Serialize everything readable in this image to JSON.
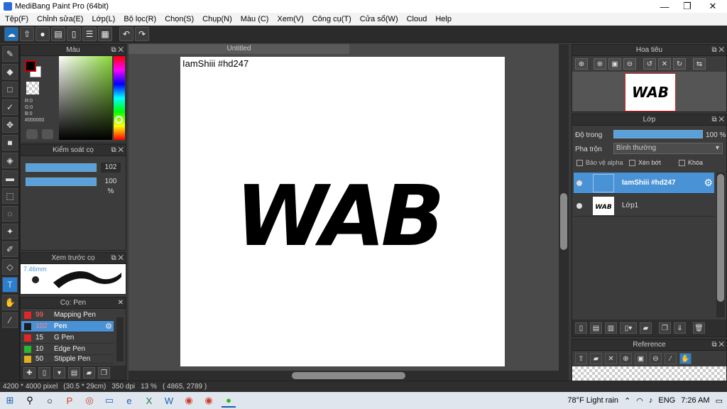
{
  "window": {
    "title": "MediBang Paint Pro (64bit)",
    "minimize": "—",
    "maximize": "❐",
    "close": "✕"
  },
  "menu": [
    "Tệp(F)",
    "Chỉnh sửa(E)",
    "Lớp(L)",
    "Bộ lọc(R)",
    "Chọn(S)",
    "Chụp(N)",
    "Màu (C)",
    "Xem(V)",
    "Công cụ(T)",
    "Cửa sổ(W)",
    "Cloud",
    "Help"
  ],
  "toolbar_icons": [
    "cloud-icon",
    "upload-icon",
    "chat-icon",
    "comment-icon",
    "document-icon",
    "list-icon",
    "grid-icon",
    "undo-icon",
    "redo-icon"
  ],
  "tools": [
    "brush-icon",
    "eraser-icon",
    "rectangle-icon",
    "smudge-icon",
    "move-icon",
    "fill-rect-icon",
    "bucket-icon",
    "gradient-icon",
    "select-rect-icon",
    "lasso-icon",
    "magic-wand-icon",
    "select-pen-icon",
    "select-eraser-icon",
    "text-icon",
    "hand-icon",
    "eyedropper-icon",
    "operation-icon"
  ],
  "color_panel": {
    "title": "Màu",
    "r": "R:0",
    "g": "G:0",
    "b": "B:0",
    "hex": "#000000"
  },
  "brush_control": {
    "title": "Kiểm soát cọ",
    "size": "102",
    "opacity": "100 %"
  },
  "brush_preview": {
    "title": "Xem trước cọ",
    "size": "7.46mm"
  },
  "brush_list": {
    "title": "Cọ: Pen",
    "items": [
      {
        "num": "99",
        "name": "Mapping Pen",
        "color": "#e02626"
      },
      {
        "num": "102",
        "name": "Pen",
        "color": "#1e1e1e"
      },
      {
        "num": "15",
        "name": "G Pen",
        "color": "#e02626"
      },
      {
        "num": "10",
        "name": "Edge Pen",
        "color": "#2db52d"
      },
      {
        "num": "50",
        "name": "Stipple Pen",
        "color": "#e0b020"
      }
    ]
  },
  "canvas": {
    "tab": "Untitled",
    "text": "IamShiii #hd247",
    "art": "WAB"
  },
  "navigator": {
    "title": "Hoa tiêu"
  },
  "layers": {
    "title": "Lớp",
    "opacity_label": "Độ trong",
    "opacity_value": "100 %",
    "blend_label": "Pha trộn",
    "blend_value": "Bình thường",
    "protect_alpha": "Bảo vệ alpha",
    "clipping": "Xén bớt",
    "lock": "Khóa",
    "items": [
      {
        "name": "IamShiii #hd247"
      },
      {
        "name": "Lớp1"
      }
    ]
  },
  "reference": {
    "title": "Reference"
  },
  "status": {
    "size": "4200 * 4000 pixel",
    "cm": "(30.5 * 29cm)",
    "dpi": "350 dpi",
    "zoom": "13 %",
    "coord": "( 4865, 2789 )"
  },
  "taskbar": {
    "weather": "78°F  Light rain",
    "lang": "ENG",
    "time": "7:26 AM"
  }
}
